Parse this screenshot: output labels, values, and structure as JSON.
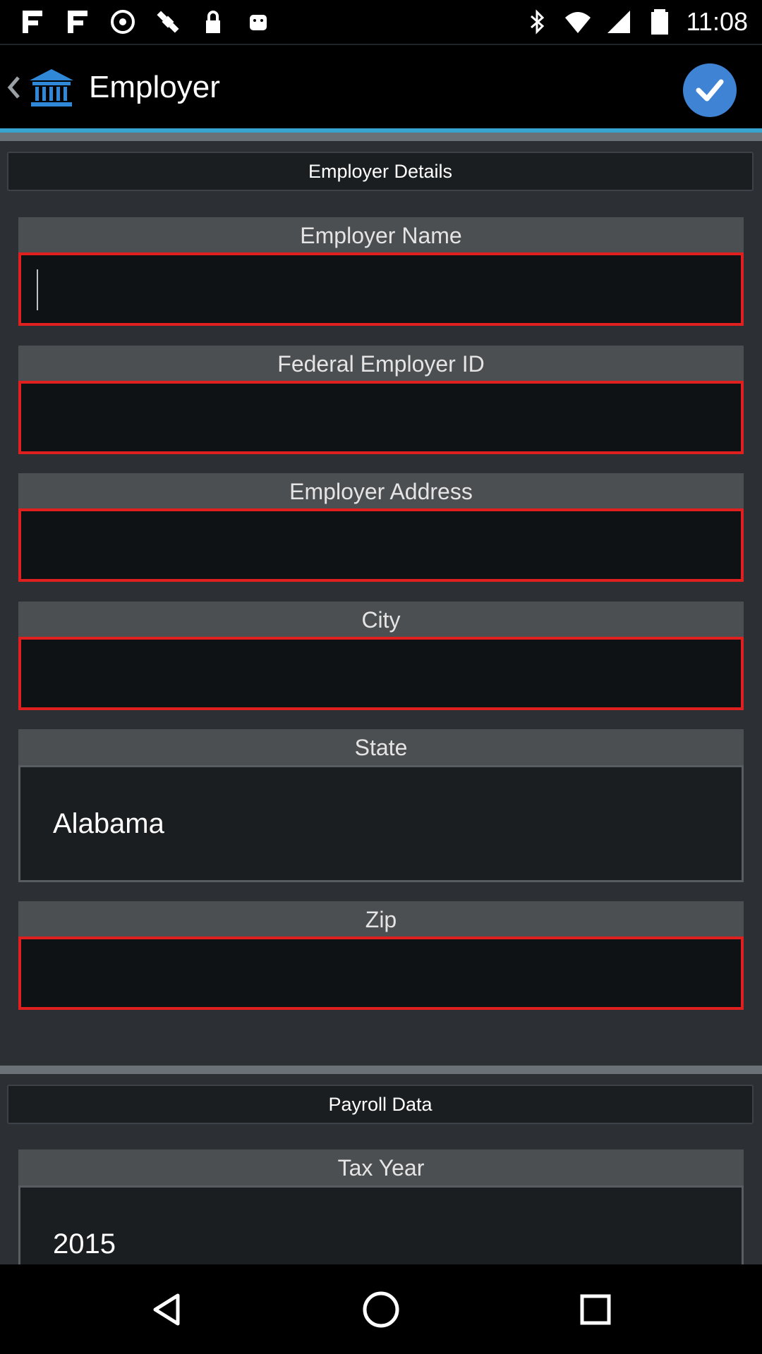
{
  "status_bar": {
    "time": "11:08",
    "left_icons": [
      "signal-icon",
      "signal-icon",
      "sync-icon",
      "satellite-icon",
      "lock-icon",
      "android-icon"
    ],
    "right_icons": [
      "bluetooth-icon",
      "wifi-icon",
      "cellular-icon",
      "battery-icon"
    ]
  },
  "app_bar": {
    "title": "Employer",
    "logo_icon": "bank-icon",
    "confirm_icon": "checkmark-icon",
    "accent_color": "#37a5d0"
  },
  "sections": {
    "employer_details": "Employer Details",
    "payroll_data": "Payroll Data"
  },
  "fields": {
    "employer_name": {
      "label": "Employer Name",
      "value": ""
    },
    "federal_employer_id": {
      "label": "Federal Employer ID",
      "value": ""
    },
    "employer_address": {
      "label": "Employer Address",
      "value": ""
    },
    "city": {
      "label": "City",
      "value": ""
    },
    "state": {
      "label": "State",
      "value": "Alabama"
    },
    "zip": {
      "label": "Zip",
      "value": ""
    },
    "tax_year": {
      "label": "Tax Year",
      "value": "2015"
    }
  },
  "nav_bar": {
    "back_icon": "triangle-back-icon",
    "home_icon": "circle-home-icon",
    "recents_icon": "square-recents-icon"
  }
}
